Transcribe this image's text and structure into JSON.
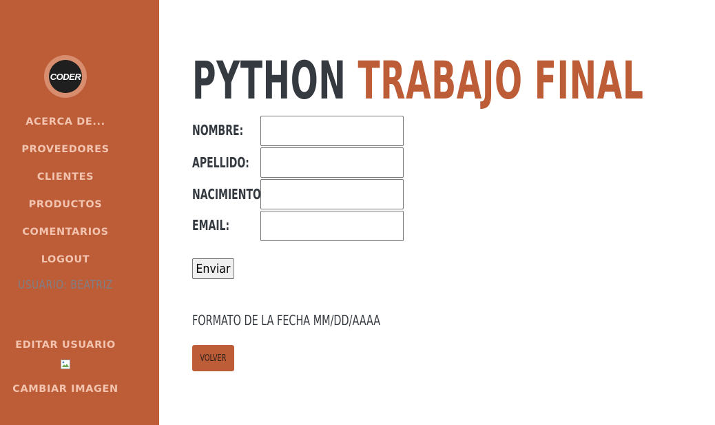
{
  "sidebar": {
    "logo_text": "CODER",
    "items": [
      {
        "label": "ACERCA DE..."
      },
      {
        "label": "PROVEEDORES"
      },
      {
        "label": "CLIENTES"
      },
      {
        "label": "PRODUCTOS"
      },
      {
        "label": "COMENTARIOS"
      },
      {
        "label": "LOGOUT"
      }
    ],
    "user_label": "USUARIO: BEATRIZ",
    "edit_user": "EDITAR USUARIO",
    "change_image": "CAMBIAR IMAGEN",
    "image_icon": "broken-image-icon"
  },
  "main": {
    "title_part1": "PYTHON",
    "title_part2": "TRABAJO FINAL",
    "fields": [
      {
        "label": "NOMBRE:",
        "value": ""
      },
      {
        "label": "APELLIDO:",
        "value": ""
      },
      {
        "label": "NACIMIENTO:",
        "value": ""
      },
      {
        "label": "EMAIL:",
        "value": ""
      }
    ],
    "submit_label": "Enviar",
    "date_hint": "FORMATO DE LA FECHA MM/DD/AAAA",
    "back_label": "VOLVER"
  },
  "colors": {
    "sidebar_bg": "#bd5d38",
    "accent": "#bd5d38",
    "title_dark": "#343a40",
    "nav_text": "#f2c4b0"
  }
}
